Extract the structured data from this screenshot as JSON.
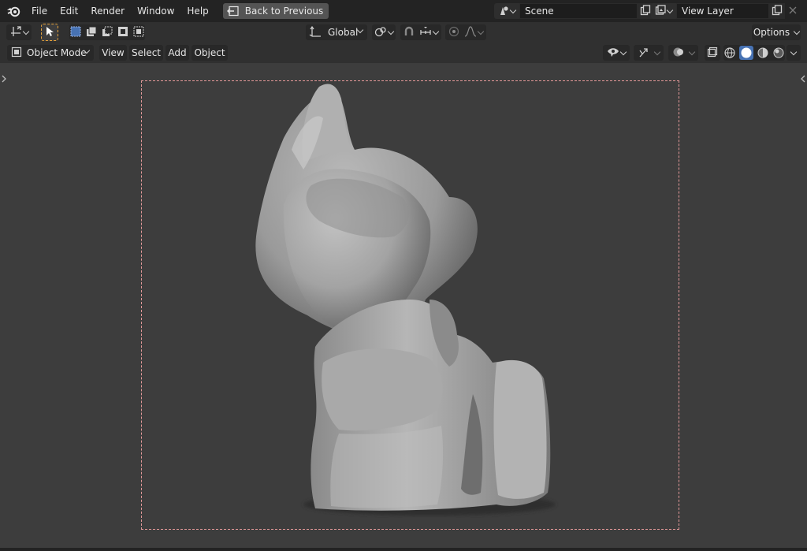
{
  "menubar": {
    "items": [
      "File",
      "Edit",
      "Render",
      "Window",
      "Help"
    ],
    "back_button": "Back to Previous",
    "scene_name": "Scene",
    "view_layer_name": "View Layer"
  },
  "toolbar": {
    "transform_orientation": "Global",
    "options_label": "Options"
  },
  "header": {
    "mode": "Object Mode",
    "menus": [
      "View",
      "Select",
      "Add",
      "Object"
    ]
  },
  "colors": {
    "accent": "#4772b3",
    "camera_frame": "#e59a9a",
    "viewport_bg": "#3d3d3d"
  },
  "icons": [
    "blender-logo-icon",
    "back-icon",
    "scene-icon",
    "view-layer-icon",
    "copy-icon",
    "close-icon",
    "transform-icon",
    "select-tool-icon",
    "orientation-icon",
    "pivot-icon",
    "snap-icon",
    "proportional-icon",
    "object-mode-icon",
    "visibility-icon",
    "gizmo-icon",
    "overlay-icon",
    "xray-icon",
    "wireframe-shading-icon",
    "solid-shading-icon",
    "material-shading-icon",
    "rendered-shading-icon"
  ]
}
